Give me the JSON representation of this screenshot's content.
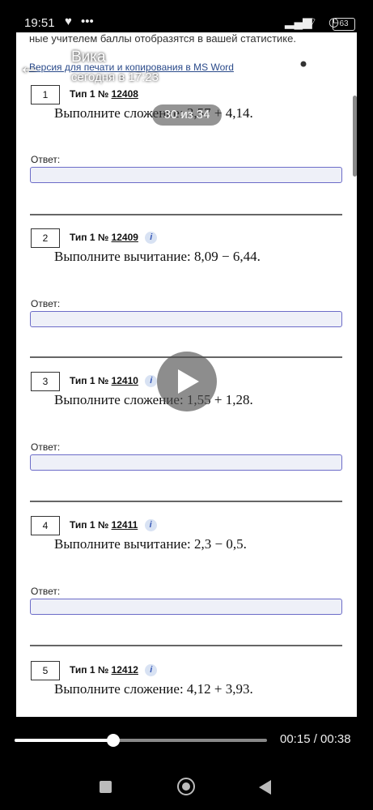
{
  "status_bar": {
    "time": "19:51",
    "battery": "63"
  },
  "header": {
    "sender": "Вика",
    "sent_time": "сегодня в 17:23",
    "counter": "30 из 34"
  },
  "document": {
    "top_note": "ные учителем баллы отобразятся в вашей статистике.",
    "print_link": "Версия для печати и копирования в MS Word",
    "answer_label": "Ответ:",
    "tasks": [
      {
        "number": "1",
        "type": "Тип 1 №",
        "id": "12408",
        "question": "Выполните сложение: 3,57 + 4,14."
      },
      {
        "number": "2",
        "type": "Тип 1 №",
        "id": "12409",
        "question": "Выполните вычитание: 8,09 − 6,44."
      },
      {
        "number": "3",
        "type": "Тип 1 №",
        "id": "12410",
        "question": "Выполните сложение: 1,55 + 1,28."
      },
      {
        "number": "4",
        "type": "Тип 1 №",
        "id": "12411",
        "question": "Выполните вычитание: 2,3 − 0,5."
      },
      {
        "number": "5",
        "type": "Тип 1 №",
        "id": "12412",
        "question": "Выполните сложение: 4,12 + 3,93."
      }
    ]
  },
  "video": {
    "timecode": "00:15 / 00:38",
    "progress_fraction": 0.39
  },
  "icons": {
    "back": "back-arrow-icon",
    "share": "share-icon",
    "settings": "gear-icon",
    "more": "more-vertical-icon",
    "play": "play-icon",
    "info": "info-icon"
  },
  "colors": {
    "input_border": "#6c6cc8",
    "input_fill": "#eef0f8",
    "link": "#2a4a8a",
    "info_badge": "#3b5cb8"
  }
}
